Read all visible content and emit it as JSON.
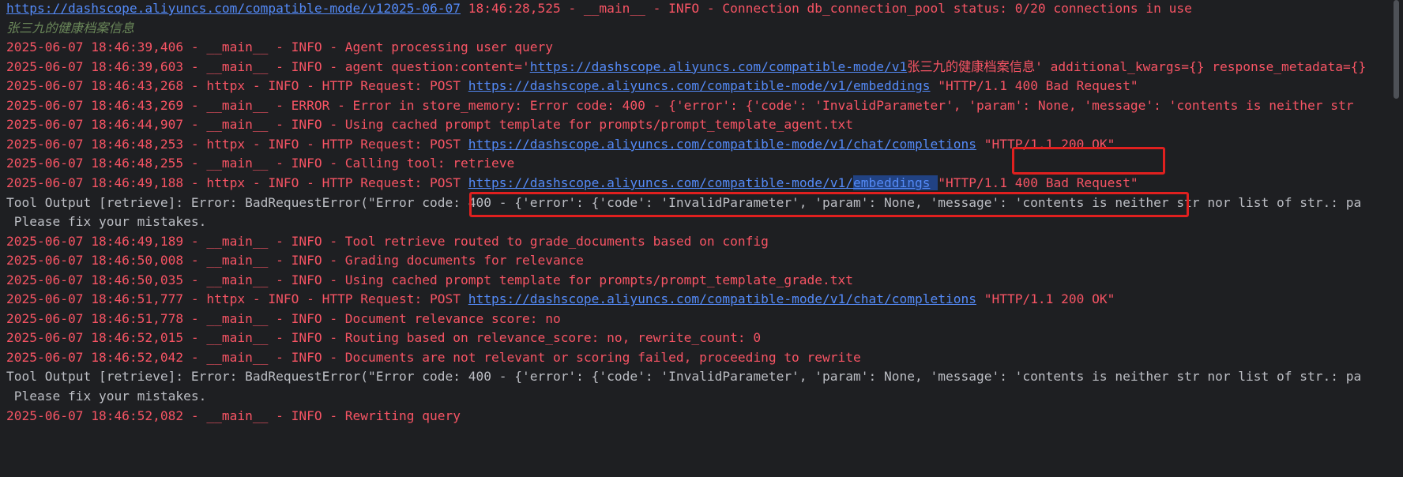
{
  "colors": {
    "background": "#1e1f22",
    "log_text": "#f75464",
    "link": "#548af7",
    "plain_text": "#bcbec4",
    "input_echo": "#6a8759",
    "selection": "#214283",
    "highlight_box": "#e0201f"
  },
  "lines": [
    {
      "segs": [
        {
          "t": "https://dashscope.aliyuncs.com/compatible-mode/v12025-06-07",
          "c": "link"
        },
        {
          "t": " 18:46:28,525 - __main__ - INFO - Connection db_connection_pool status: 0/20 connections in use"
        }
      ]
    },
    {
      "echo": "张三九的健康档案信息"
    },
    {
      "segs": [
        {
          "t": "2025-06-07 18:46:39,406 - __main__ - INFO - Agent processing user query"
        }
      ]
    },
    {
      "segs": [
        {
          "t": "2025-06-07 18:46:39,603 - __main__ - INFO - agent question:content='"
        },
        {
          "t": "https://dashscope.aliyuncs.com/compatible-mode/v1",
          "c": "link"
        },
        {
          "t": "张三九的健康档案信息' additional_kwargs={} response_metadata={}"
        }
      ]
    },
    {
      "segs": [
        {
          "t": "2025-06-07 18:46:43,268 - httpx - INFO - HTTP Request: POST "
        },
        {
          "t": "https://dashscope.aliyuncs.com/compatible-mode/v1/embeddings",
          "c": "link"
        },
        {
          "t": " \"HTTP/1.1 400 Bad Request\""
        }
      ]
    },
    {
      "segs": [
        {
          "t": "2025-06-07 18:46:43,269 - __main__ - ERROR - Error in store_memory: Error code: 400 - {'error': {'code': 'InvalidParameter', 'param': None, 'message': 'contents is neither str"
        }
      ]
    },
    {
      "segs": [
        {
          "t": "2025-06-07 18:46:44,907 - __main__ - INFO - Using cached prompt template for prompts/prompt_template_agent.txt"
        }
      ]
    },
    {
      "segs": [
        {
          "t": "2025-06-07 18:46:48,253 - httpx - INFO - HTTP Request: POST "
        },
        {
          "t": "https://dashscope.aliyuncs.com/compatible-mode/v1/chat/completions",
          "c": "link"
        },
        {
          "t": " \"HTTP/1.1 200 OK\""
        }
      ]
    },
    {
      "segs": [
        {
          "t": "2025-06-07 18:46:48,255 - __main__ - INFO - Calling tool: retrieve"
        }
      ]
    },
    {
      "segs": [
        {
          "t": "2025-06-07 18:46:49,188 - httpx - INFO - HTTP Request: POST "
        },
        {
          "t": "https://dashscope.aliyuncs.com/compatible-mode/v1/",
          "c": "link"
        },
        {
          "t": "embeddings",
          "c": "link sel"
        },
        {
          "t": " ",
          "c": "sel"
        },
        {
          "t": "\"HTTP/1.1 400 Bad Request\""
        }
      ]
    },
    {
      "segs": [
        {
          "t": "Tool Output [retrieve]: Error: BadRequestError(\"Error code: 400 - {'error': {'code': 'InvalidParameter', 'param': None, 'message': 'contents is neither str nor list of str.: pa",
          "c": "white"
        }
      ]
    },
    {
      "segs": [
        {
          "t": " Please fix your mistakes.",
          "c": "white"
        }
      ]
    },
    {
      "segs": [
        {
          "t": "2025-06-07 18:46:49,189 - __main__ - INFO - Tool retrieve routed to grade_documents based on config"
        }
      ]
    },
    {
      "segs": [
        {
          "t": "2025-06-07 18:46:50,008 - __main__ - INFO - Grading documents for relevance"
        }
      ]
    },
    {
      "segs": [
        {
          "t": "2025-06-07 18:46:50,035 - __main__ - INFO - Using cached prompt template for prompts/prompt_template_grade.txt"
        }
      ]
    },
    {
      "segs": [
        {
          "t": "2025-06-07 18:46:51,777 - httpx - INFO - HTTP Request: POST "
        },
        {
          "t": "https://dashscope.aliyuncs.com/compatible-mode/v1/chat/completions",
          "c": "link"
        },
        {
          "t": " \"HTTP/1.1 200 OK\""
        }
      ]
    },
    {
      "segs": [
        {
          "t": "2025-06-07 18:46:51,778 - __main__ - INFO - Document relevance score: no"
        }
      ]
    },
    {
      "segs": [
        {
          "t": "2025-06-07 18:46:52,015 - __main__ - INFO - Routing based on relevance_score: no, rewrite_count: 0"
        }
      ]
    },
    {
      "segs": [
        {
          "t": "2025-06-07 18:46:52,042 - __main__ - INFO - Documents are not relevant or scoring failed, proceeding to rewrite"
        }
      ]
    },
    {
      "segs": [
        {
          "t": "Tool Output [retrieve]: Error: BadRequestError(\"Error code: 400 - {'error': {'code': 'InvalidParameter', 'param': None, 'message': 'contents is neither str nor list of str.: pa",
          "c": "white"
        }
      ]
    },
    {
      "segs": [
        {
          "t": " Please fix your mistakes.",
          "c": "white"
        }
      ]
    },
    {
      "segs": [
        {
          "t": "2025-06-07 18:46:52,082 - __main__ - INFO - Rewriting query"
        }
      ]
    }
  ]
}
